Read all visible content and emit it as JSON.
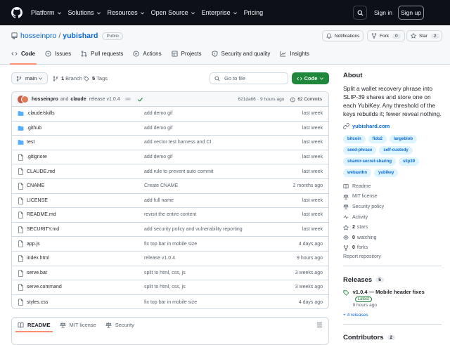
{
  "nav": {
    "items": [
      {
        "label": "Platform"
      },
      {
        "label": "Solutions"
      },
      {
        "label": "Resources"
      },
      {
        "label": "Open Source"
      },
      {
        "label": "Enterprise"
      },
      {
        "label": "Pricing"
      }
    ],
    "sign_in": "Sign in",
    "sign_up": "Sign up"
  },
  "repo": {
    "owner": "hosseinpro",
    "separator": "/",
    "name": "yubishard",
    "visibility": "Public",
    "notifications_label": "Notifications",
    "fork_label": "Fork",
    "fork_count": "0",
    "star_label": "Star",
    "star_count": "2"
  },
  "tabs": [
    {
      "label": "Code"
    },
    {
      "label": "Issues"
    },
    {
      "label": "Pull requests"
    },
    {
      "label": "Actions"
    },
    {
      "label": "Projects"
    },
    {
      "label": "Security and quality"
    },
    {
      "label": "Insights"
    }
  ],
  "toolbar": {
    "branch": "main",
    "branch_count": "1",
    "branch_label": "Branch",
    "tag_count": "5",
    "tag_label": "Tags",
    "goto_placeholder": "Go to file",
    "code_label": "Code"
  },
  "commit": {
    "author1": "hosseinpro",
    "and": "and",
    "author2": "claude",
    "message": "release v1.0.4",
    "sha": "621da66",
    "separator": "·",
    "time": "9 hours ago",
    "commits": "62 Commits"
  },
  "files": [
    {
      "name": ".claude/skills",
      "type": "dir",
      "message": "add demo gif",
      "date": "last week"
    },
    {
      "name": ".github",
      "type": "dir",
      "message": "add demo gif",
      "date": "last week"
    },
    {
      "name": "test",
      "type": "dir",
      "message": "add vector test harness and CI",
      "date": "last week"
    },
    {
      "name": ".gitignore",
      "type": "file",
      "message": "add demo gif",
      "date": "last week"
    },
    {
      "name": "CLAUDE.md",
      "type": "file",
      "message": "add rule to prevent auto commit",
      "date": "last week"
    },
    {
      "name": "CNAME",
      "type": "file",
      "message": "Create CNAME",
      "date": "2 months ago"
    },
    {
      "name": "LICENSE",
      "type": "file",
      "message": "add full name",
      "date": "last week"
    },
    {
      "name": "README.md",
      "type": "file",
      "message": "revisit the entire content",
      "date": "last week"
    },
    {
      "name": "SECURITY.md",
      "type": "file",
      "message": "add security policy and vulnerability reporting",
      "date": "last week"
    },
    {
      "name": "app.js",
      "type": "file",
      "message": "fix top bar in mobile size",
      "date": "4 days ago"
    },
    {
      "name": "index.html",
      "type": "file",
      "message": "release v1.0.4",
      "date": "9 hours ago"
    },
    {
      "name": "serve.bat",
      "type": "file",
      "message": "split to html, css, js",
      "date": "3 weeks ago"
    },
    {
      "name": "serve.command",
      "type": "file",
      "message": "split to html, css, js",
      "date": "3 weeks ago"
    },
    {
      "name": "styles.css",
      "type": "file",
      "message": "fix top bar in mobile size",
      "date": "4 days ago"
    }
  ],
  "readme_tabs": [
    {
      "label": "README"
    },
    {
      "label": "MIT license"
    },
    {
      "label": "Security"
    }
  ],
  "about": {
    "heading": "About",
    "description": "Split a wallet recovery phrase into SLIP-39 shares and store one on each YubiKey. Any threshold of the keys rebuilds it; fewer reveal nothing.",
    "homepage": "yubishard.com",
    "topics": [
      "bitcoin",
      "fido2",
      "largeblob",
      "seed-phrase",
      "self-custody",
      "shamir-secret-sharing",
      "slip39",
      "webauthn",
      "yubikey"
    ],
    "readme": "Readme",
    "license": "MIT license",
    "security_policy": "Security policy",
    "activity": "Activity",
    "stars_count": "2",
    "stars_label": "stars",
    "watching_count": "0",
    "watching_label": "watching",
    "forks_count": "0",
    "forks_label": "forks",
    "report": "Report repository"
  },
  "releases": {
    "heading": "Releases",
    "count": "5",
    "latest_title": "v1.0.4 — Mobile header fixes",
    "latest_badge": "Latest",
    "latest_date": "9 hours ago",
    "more": "+ 4 releases"
  },
  "contributors": {
    "heading": "Contributors",
    "count": "2"
  },
  "colors": {
    "header_bg": "#0d1117",
    "accent": "#0969da",
    "code_button": "#1f883d",
    "tab_underline": "#fd8c73",
    "topic_bg": "#ddf4ff"
  }
}
